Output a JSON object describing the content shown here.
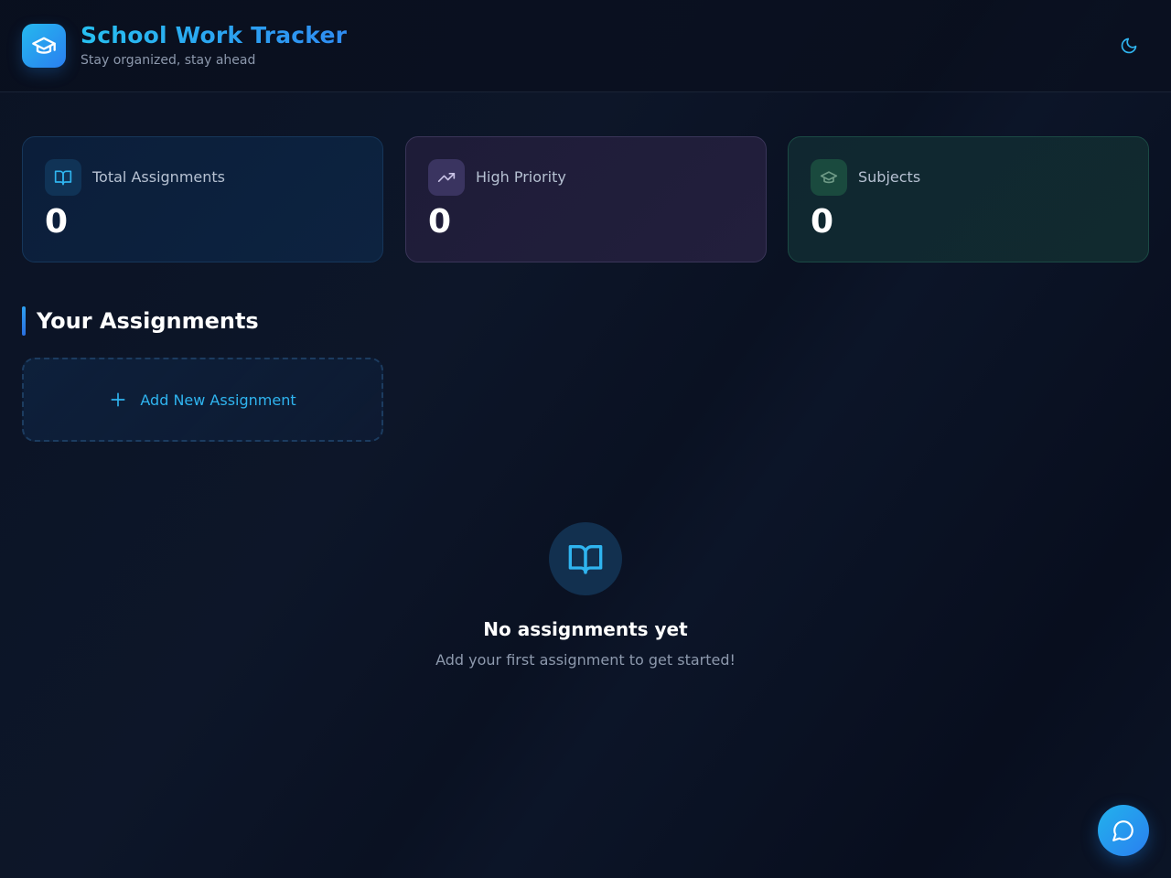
{
  "header": {
    "title": "School Work Tracker",
    "subtitle": "Stay organized, stay ahead",
    "logo_icon": "graduation-cap-icon",
    "theme_icon": "moon-icon"
  },
  "stats": [
    {
      "label": "Total Assignments",
      "value": "0",
      "icon": "book-open-icon",
      "accent": "#2fb4ef"
    },
    {
      "label": "High Priority",
      "value": "0",
      "icon": "trending-up-icon",
      "accent": "#b9b3d9"
    },
    {
      "label": "Subjects",
      "value": "0",
      "icon": "graduation-cap-icon",
      "accent": "#5c8f78"
    }
  ],
  "section": {
    "title": "Your Assignments"
  },
  "add_assignment": {
    "label": "Add New Assignment",
    "icon": "plus-icon"
  },
  "empty_state": {
    "icon": "book-open-icon",
    "title": "No assignments yet",
    "subtitle": "Add your first assignment to get started!"
  },
  "chat": {
    "icon": "chat-bubble-icon"
  },
  "colors": {
    "accent": "#2fb4ef",
    "background": "#0b1324"
  }
}
